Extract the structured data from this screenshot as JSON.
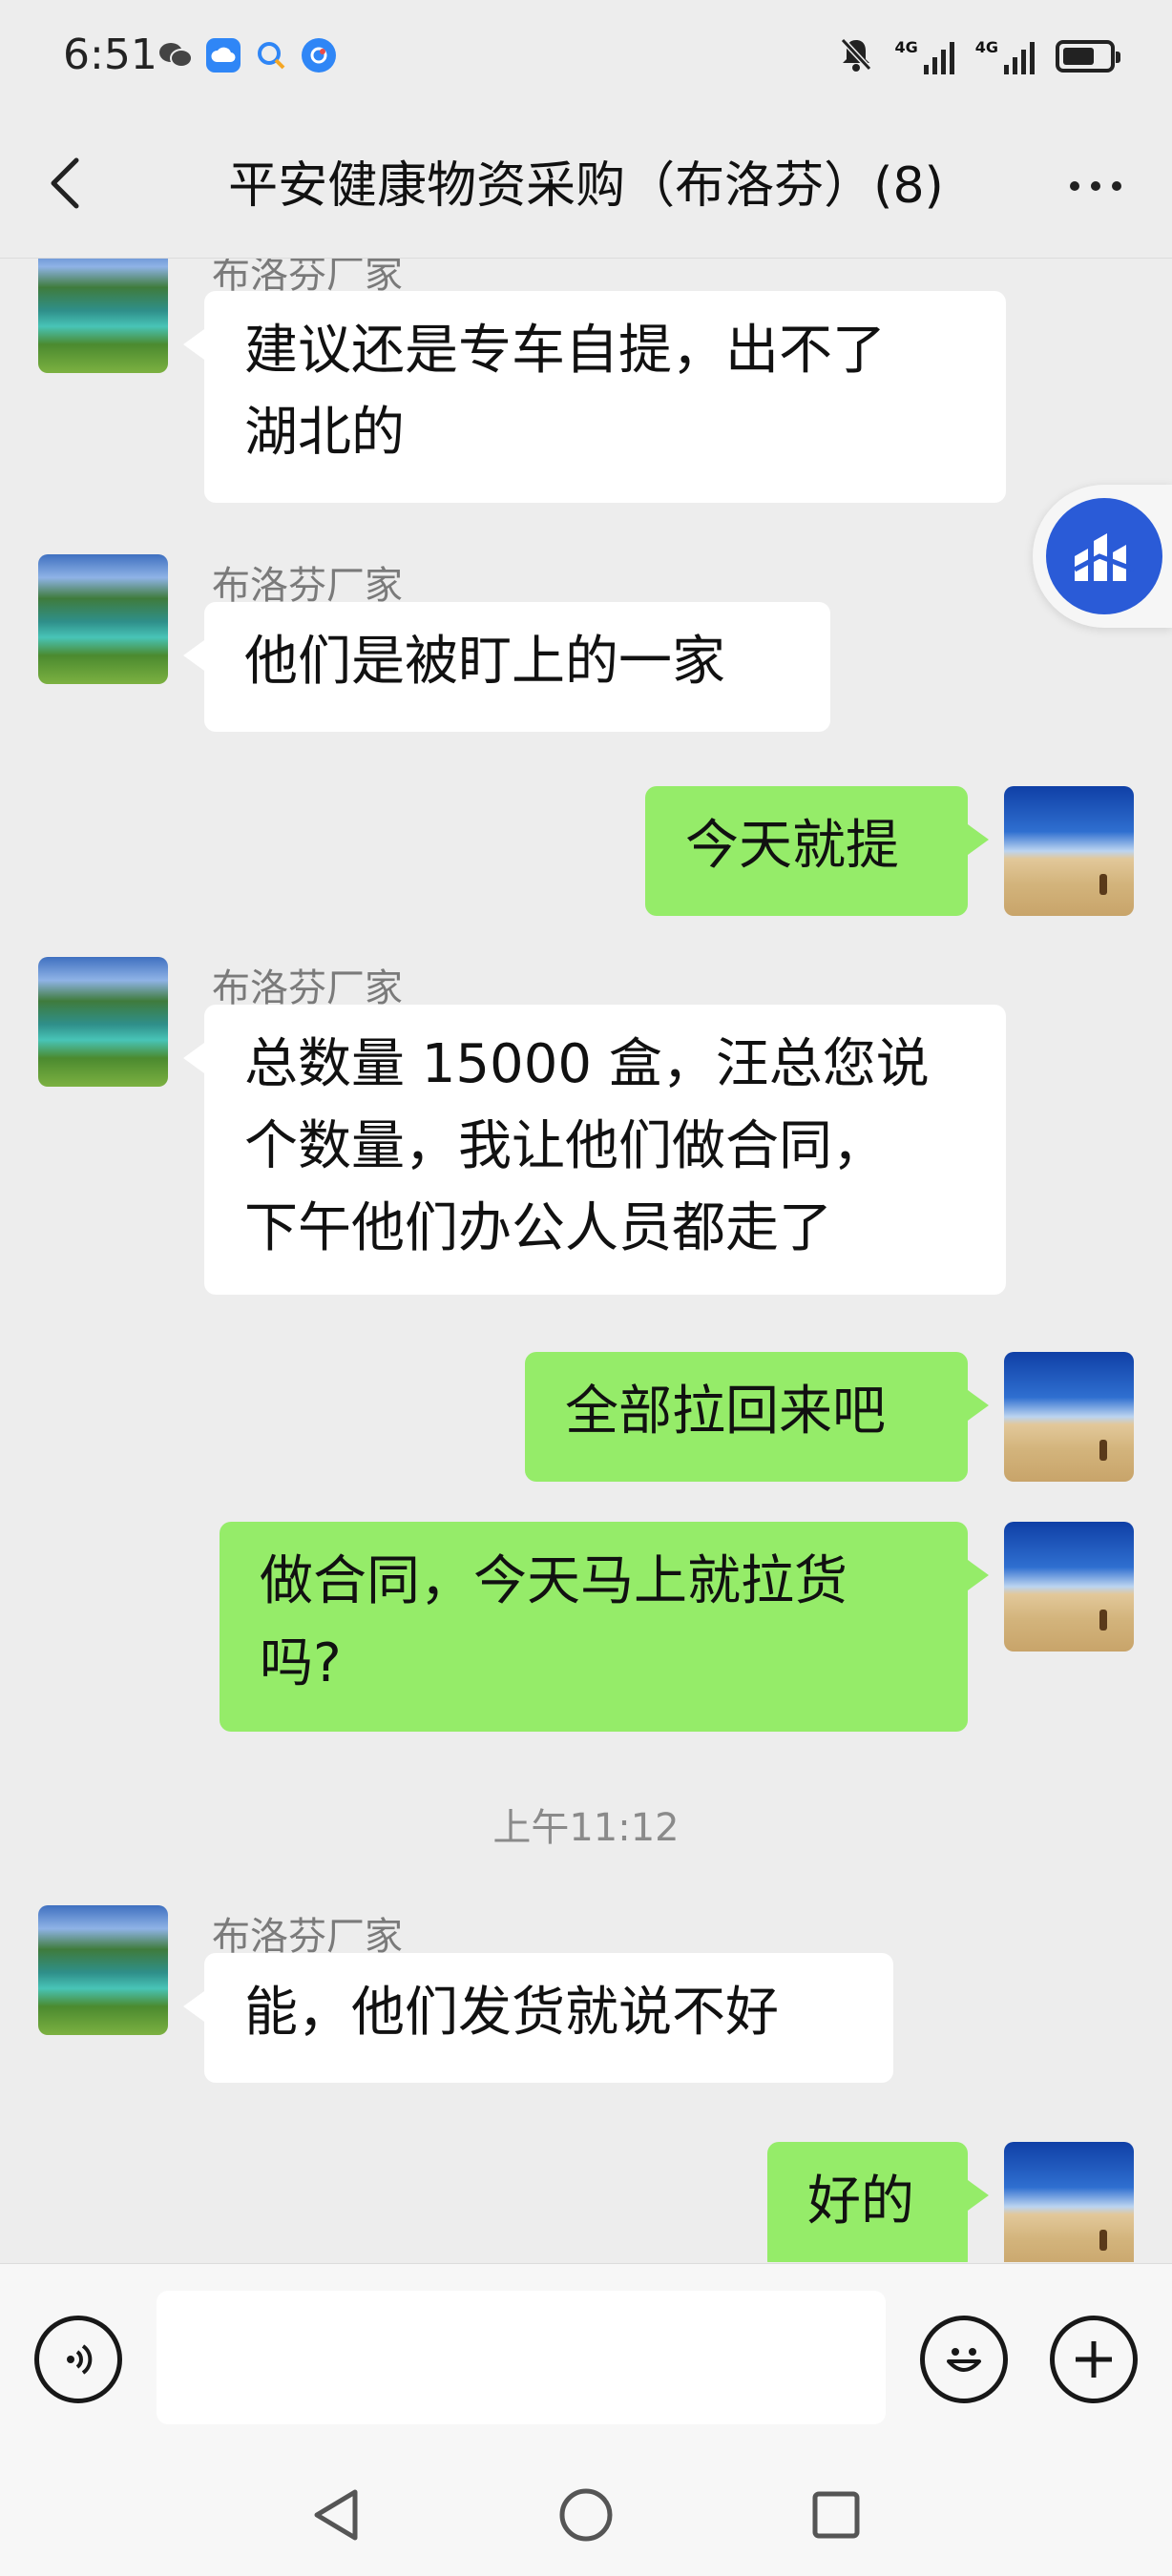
{
  "status_bar": {
    "time": "6:51",
    "network_1": "4G",
    "network_2": "4G",
    "battery_level": 0.7
  },
  "header": {
    "title": "平安健康物资采购（布洛芬）(8)"
  },
  "messages": [
    {
      "direction": "in",
      "sender": "布洛芬厂家",
      "text": "建议还是专车自提，出不了\n湖北的"
    },
    {
      "direction": "in",
      "sender": "布洛芬厂家",
      "text": "他们是被盯上的一家"
    },
    {
      "direction": "out",
      "text": "今天就提"
    },
    {
      "direction": "in",
      "sender": "布洛芬厂家",
      "text": "总数量 15000 盒，汪总您说\n个数量，我让他们做合同，\n下午他们办公人员都走了"
    },
    {
      "direction": "out",
      "text": "全部拉回来吧"
    },
    {
      "direction": "out",
      "text": "做合同，今天马上就拉货\n吗?"
    },
    {
      "direction": "in",
      "sender": "布洛芬厂家",
      "text": "能，他们发货就说不好"
    },
    {
      "direction": "out",
      "text": "好的"
    }
  ],
  "timestamp": "上午11:12",
  "input": {
    "value": "",
    "placeholder": ""
  },
  "colors": {
    "incoming_bubble": "#ffffff",
    "outgoing_bubble": "#95ec69",
    "background": "#ededed",
    "float_button": "#2a5bd7"
  }
}
